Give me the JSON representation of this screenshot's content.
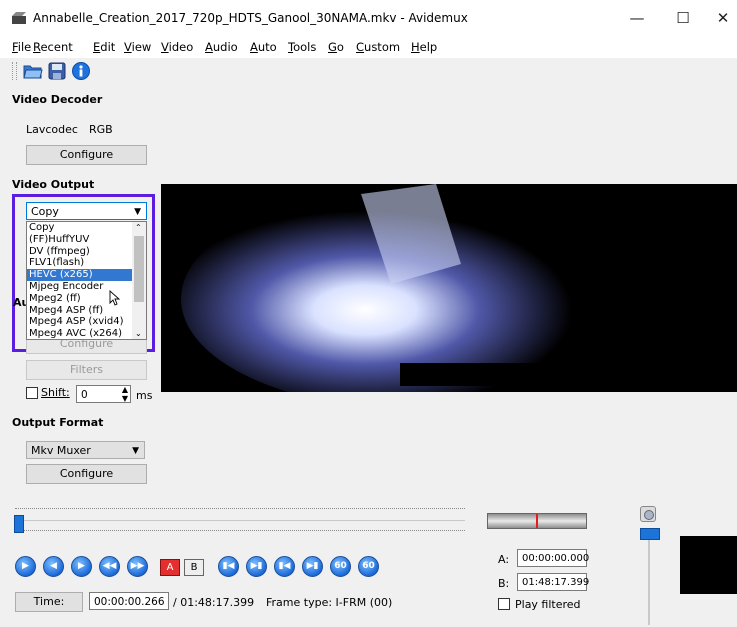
{
  "window": {
    "title": "Annabelle_Creation_2017_720p_HDTS_Ganool_30NAMA.mkv - Avidemux",
    "minimize": "—",
    "maximize": "☐",
    "close": "✕"
  },
  "menu": [
    "File",
    "Recent",
    "Edit",
    "View",
    "Video",
    "Audio",
    "Auto",
    "Tools",
    "Go",
    "Custom",
    "Help"
  ],
  "decoder": {
    "heading": "Video Decoder",
    "codec": "Lavcodec",
    "format": "RGB",
    "configure": "Configure"
  },
  "video_output": {
    "heading": "Video Output",
    "selected": "Copy",
    "options": [
      "Copy",
      "(FF)HuffYUV",
      "DV (ffmpeg)",
      "FLV1(flash)",
      "HEVC (x265)",
      "Mjpeg Encoder",
      "Mpeg2 (ff)",
      "Mpeg4 ASP (ff)",
      "Mpeg4 ASP (xvid4)",
      "Mpeg4 AVC (x264)"
    ],
    "highlighted": "HEVC (x265)",
    "configure": "Configure"
  },
  "audio": {
    "heading_partial": "Au",
    "filters": "Filters",
    "shift_label": "Shift:",
    "shift_value": "0",
    "shift_unit": "ms"
  },
  "output_format": {
    "heading": "Output Format",
    "selected": "Mkv Muxer",
    "configure": "Configure"
  },
  "playback": {
    "time_button": "Time:",
    "current_time": "00:00:00.266",
    "total_time": "/ 01:48:17.399",
    "frame_type": "Frame type: I-FRM (00)",
    "ab_buttons": [
      "A",
      "B"
    ]
  },
  "markers": {
    "a_label": "A:",
    "a_value": "00:00:00.000",
    "b_label": "B:",
    "b_value": "01:48:17.399",
    "play_filtered": "Play filtered"
  },
  "colors": {
    "highlight": "#5b1ee0",
    "selection": "#3378d0",
    "nav_blue": "#1c6ad9"
  }
}
